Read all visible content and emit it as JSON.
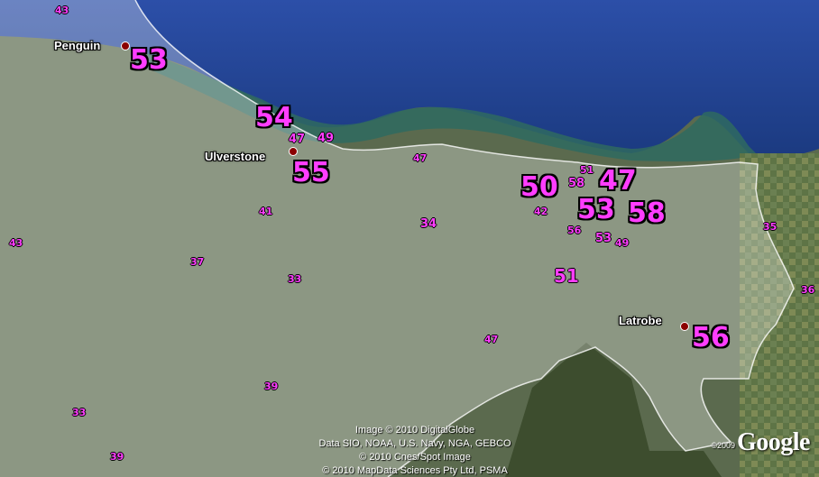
{
  "map": {
    "towns": [
      {
        "name": "Penguin",
        "id": "penguin"
      },
      {
        "name": "Ulverstone",
        "id": "ulverstone"
      },
      {
        "name": "Latrobe",
        "id": "latrobe"
      }
    ],
    "booth_results": [
      "53",
      "54",
      "55",
      "50",
      "47",
      "53",
      "58",
      "56",
      "51",
      "47",
      "49",
      "58",
      "51",
      "42",
      "56",
      "53",
      "49",
      "34",
      "41",
      "47",
      "37",
      "33",
      "47",
      "43",
      "43",
      "39",
      "33",
      "39",
      "35",
      "36"
    ],
    "colors": {
      "label_magenta": "#ff3dff",
      "town_dot": "#8b0000",
      "sea": "#1f3f8f",
      "overlay": "#ffffff"
    }
  },
  "attribution": {
    "line1": "Image © 2010 DigitalGlobe",
    "line2": "Data SIO, NOAA, U.S. Navy, NGA, GEBCO",
    "line3": "© 2010 Cnes/Spot Image",
    "line4": "© 2010 MapData Sciences Pty Ltd, PSMA"
  },
  "logo": {
    "year": "©2009",
    "text": "Google"
  }
}
